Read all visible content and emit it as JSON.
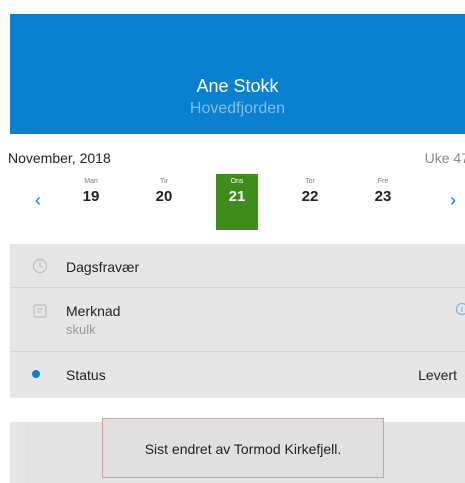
{
  "header": {
    "name": "Ane Stokk",
    "subtitle": "Hovedfjorden"
  },
  "calendar": {
    "month": "November, 2018",
    "week": "Uke 47",
    "prev_icon": "chevron-left-icon",
    "next_icon": "chevron-right-icon",
    "prev_glyph": "‹",
    "next_glyph": "›",
    "days": [
      {
        "weekday": "Man",
        "date": "19"
      },
      {
        "weekday": "Tir",
        "date": "20"
      },
      {
        "weekday": "Ons",
        "date": "21",
        "selected": true
      },
      {
        "weekday": "Tor",
        "date": "22"
      },
      {
        "weekday": "Fre",
        "date": "23"
      }
    ]
  },
  "rows": {
    "absence": {
      "label": "Dagsfravær",
      "icon": "clock-icon"
    },
    "note": {
      "label": "Merknad",
      "value": "skulk",
      "icon": "note-icon",
      "info_icon": "info-icon"
    },
    "status": {
      "label": "Status",
      "value": "Levert",
      "icon": "status-dot-icon"
    }
  },
  "toast": {
    "text": "Sist endret av Tormod Kirkefjell."
  },
  "colors": {
    "header": "#0a80d0",
    "selected_day": "#3f8c1a",
    "accent": "#0a80d0"
  }
}
